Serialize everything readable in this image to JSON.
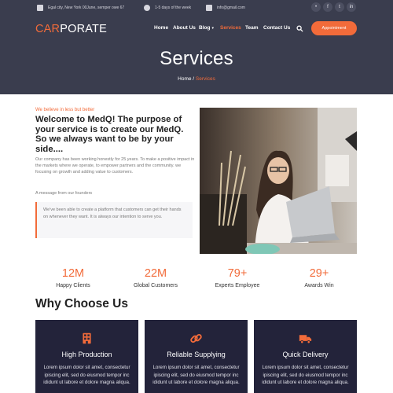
{
  "topbar": {
    "address": "Egal city, New York 00June, semper owe 67",
    "hours": "1-5 days of the week",
    "email": "info@gmail.com",
    "social": [
      "rss-icon",
      "facebook-icon",
      "twitter-icon",
      "linkedin-icon"
    ]
  },
  "brand": {
    "accent": "CAR",
    "rest": "PORATE",
    "accent_color": "#f26b3a"
  },
  "nav": {
    "items": [
      {
        "label": "Home"
      },
      {
        "label": "About Us"
      },
      {
        "label": "Blog"
      },
      {
        "label": "Services",
        "active": true
      },
      {
        "label": "Team"
      },
      {
        "label": "Contact Us"
      }
    ],
    "appointment_label": "Appointment"
  },
  "hero": {
    "title": "Services",
    "breadcrumb": {
      "home": "Home",
      "sep": " / ",
      "current": "Services"
    }
  },
  "about": {
    "tagline": "We believe in less but better",
    "heading": "Welcome to MedQ! The purpose of your service is to create our MedQ. So we always want to be by your side....",
    "paragraph": "Our company has been working honestly for 25 years. To make a positive impact in the markets where we operate, to empower partners and the community. we focusing on growth and adding value to customers.",
    "founders": "A message from our founders",
    "quote": "We've been able to create a platform that customers can get their hands on whenever they want. It is always our intention to serve you."
  },
  "stats": [
    {
      "value": "12M",
      "label": "Happy Clients"
    },
    {
      "value": "22M",
      "label": "Global Customers"
    },
    {
      "value": "79+",
      "label": "Experts Employee"
    },
    {
      "value": "29+",
      "label": "Awards Win"
    }
  ],
  "why": {
    "title": "Why Choose Us"
  },
  "features": [
    {
      "icon": "factory-icon",
      "title": "High Production",
      "text": "Lorem ipsum dolor sit amet, consectetur ipiscing elit, sed do eiusmod tempor inc ididunt ut labore et dolore magna aliqua."
    },
    {
      "icon": "link-icon",
      "title": "Reliable Supplying",
      "text": "Lorem ipsum dolor sit amet, consectetur ipiscing elit, sed do eiusmod tempor inc ididunt ut labore et dolore magna aliqua."
    },
    {
      "icon": "truck-icon",
      "title": "Quick Delivery",
      "text": "Lorem ipsum dolor sit amet, consectetur ipiscing elit, sed do eiusmod tempor inc ididunt ut labore et dolore magna aliqua."
    }
  ]
}
